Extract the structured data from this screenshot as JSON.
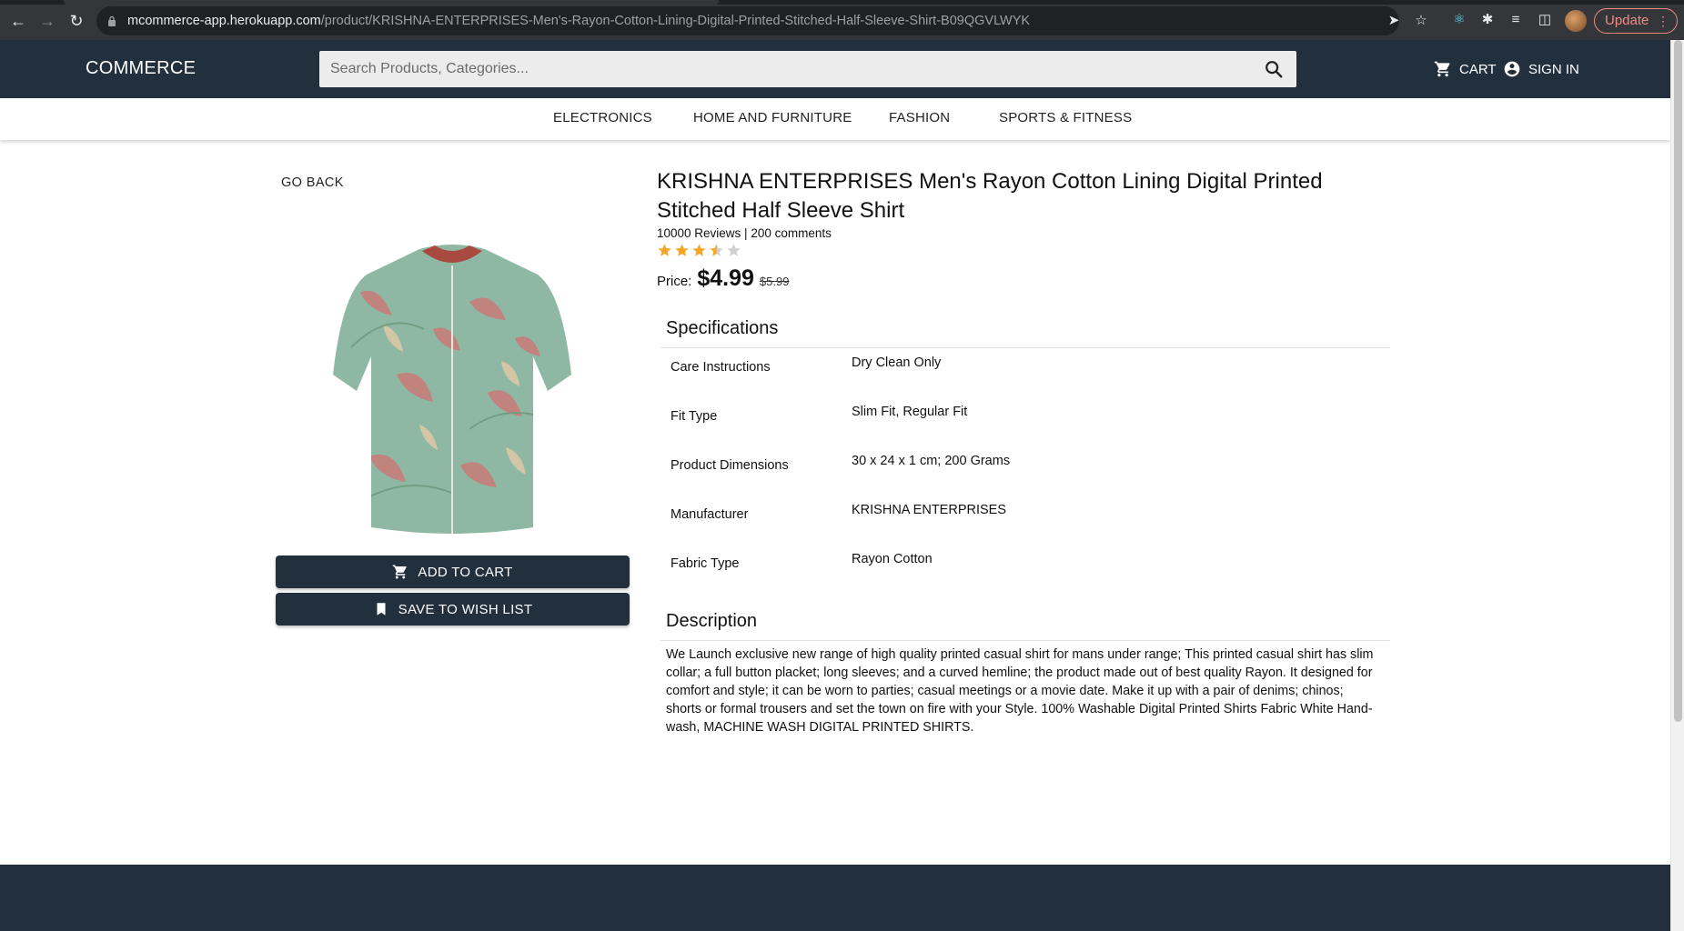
{
  "browser": {
    "url_host": "mcommerce-app.herokuapp.com",
    "url_path": "/product/KRISHNA-ENTERPRISES-Men's-Rayon-Cotton-Lining-Digital-Printed-Stitched-Half-Sleeve-Shirt-B09QGVLWYK",
    "update_label": "Update"
  },
  "header": {
    "logo": "COMMERCE",
    "search_placeholder": "Search Products, Categories...",
    "cart_label": "CART",
    "signin_label": "SIGN IN"
  },
  "categories": [
    "ELECTRONICS",
    "HOME AND FURNITURE",
    "FASHION",
    "SPORTS & FITNESS"
  ],
  "product": {
    "go_back": "GO BACK",
    "title": "KRISHNA ENTERPRISES Men's Rayon Cotton Lining Digital Printed Stitched Half Sleeve Shirt",
    "reviews_line": "10000 Reviews | 200 comments",
    "rating": 3.5,
    "rating_max": 5,
    "price_label": "Price:",
    "price": "$4.99",
    "original_price": "$5.99",
    "add_to_cart": "ADD TO CART",
    "save_to_wishlist": "SAVE TO WISH LIST"
  },
  "specifications": {
    "title": "Specifications",
    "rows": [
      {
        "key": "Care Instructions",
        "value": "Dry Clean Only"
      },
      {
        "key": "Fit Type",
        "value": "Slim Fit, Regular Fit"
      },
      {
        "key": "Product Dimensions",
        "value": "30 x 24 x 1 cm; 200 Grams"
      },
      {
        "key": "Manufacturer",
        "value": "KRISHNA ENTERPRISES"
      },
      {
        "key": "Fabric Type",
        "value": "Rayon Cotton"
      }
    ]
  },
  "description": {
    "title": "Description",
    "text": "We Launch exclusive new range of high quality printed casual shirt for mans under range; This printed casual shirt has slim collar; a full button placket; long sleeves; and a curved hemline; the product made out of best quality Rayon. It designed for comfort and style; it can be worn to parties; casual meetings or a movie date. Make it up with a pair of denims; chinos; shorts or formal trousers and set the town on fire with your Style. 100% Washable Digital Printed Shirts Fabric White Hand-wash, MACHINE WASH DIGITAL PRINTED SHIRTS."
  },
  "colors": {
    "navy": "#22303e",
    "star": "#f5a623",
    "star_empty": "#cfcfcf"
  }
}
